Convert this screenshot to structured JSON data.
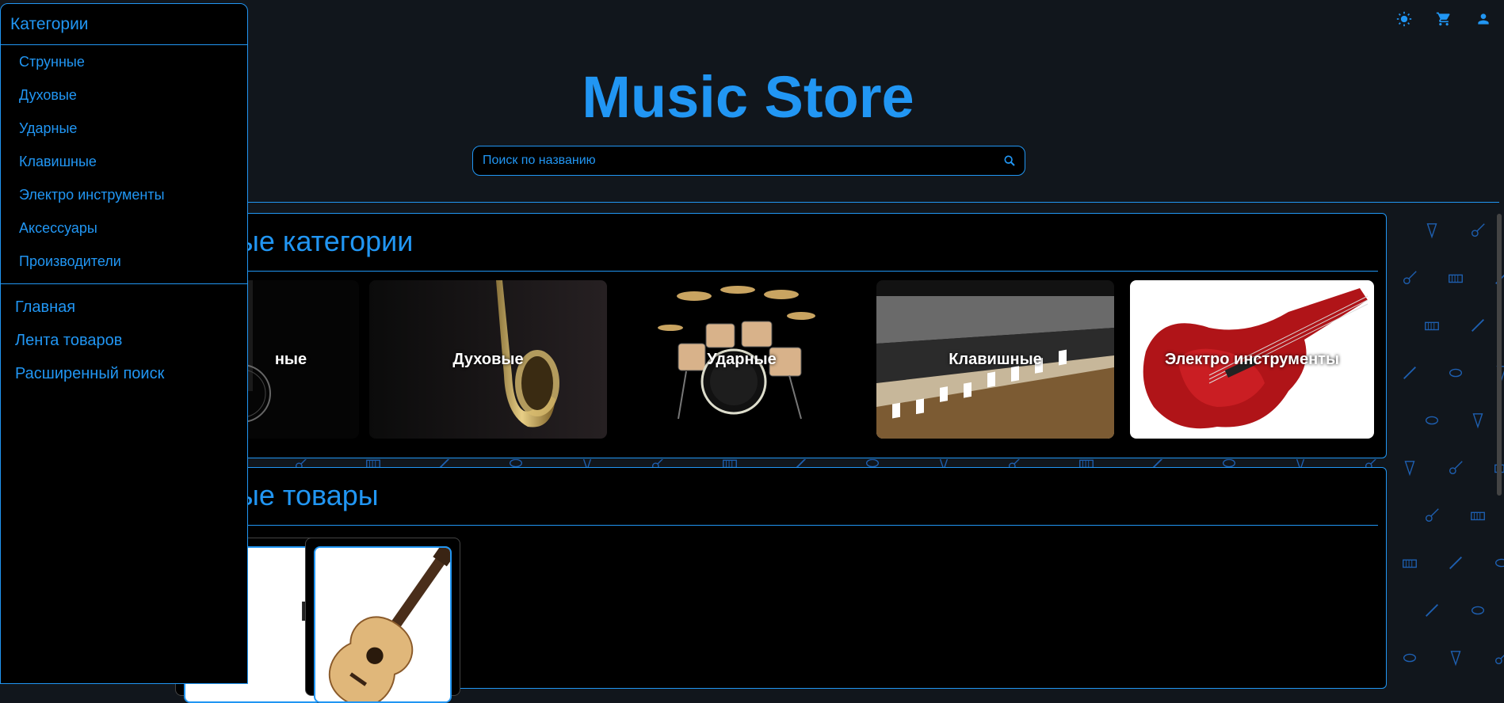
{
  "app": {
    "title": "Music Store"
  },
  "header": {
    "icons": [
      "sun-icon",
      "cart-icon",
      "user-icon"
    ]
  },
  "search": {
    "placeholder": "Поиск по названию"
  },
  "drawer": {
    "header": "Категории",
    "categories": [
      "Струнные",
      "Духовые",
      "Ударные",
      "Клавишные",
      "Электро инструменты",
      "Аксессуары",
      "Производители"
    ],
    "nav": [
      "Главная",
      "Лента товаров",
      "Расширенный поиск"
    ]
  },
  "sections": {
    "categories_title": "Популярные категории",
    "categories_title_visible": "ые категории",
    "products_title": "Популярные товары",
    "products_title_visible": "ые товары"
  },
  "category_cards": [
    {
      "label": "Струнные",
      "visible_label": "ные"
    },
    {
      "label": "Духовые"
    },
    {
      "label": "Ударные"
    },
    {
      "label": "Клавишные"
    },
    {
      "label": "Электро инструменты"
    }
  ],
  "colors": {
    "accent": "#2196f3",
    "background": "#11161c",
    "panel": "#000000"
  }
}
